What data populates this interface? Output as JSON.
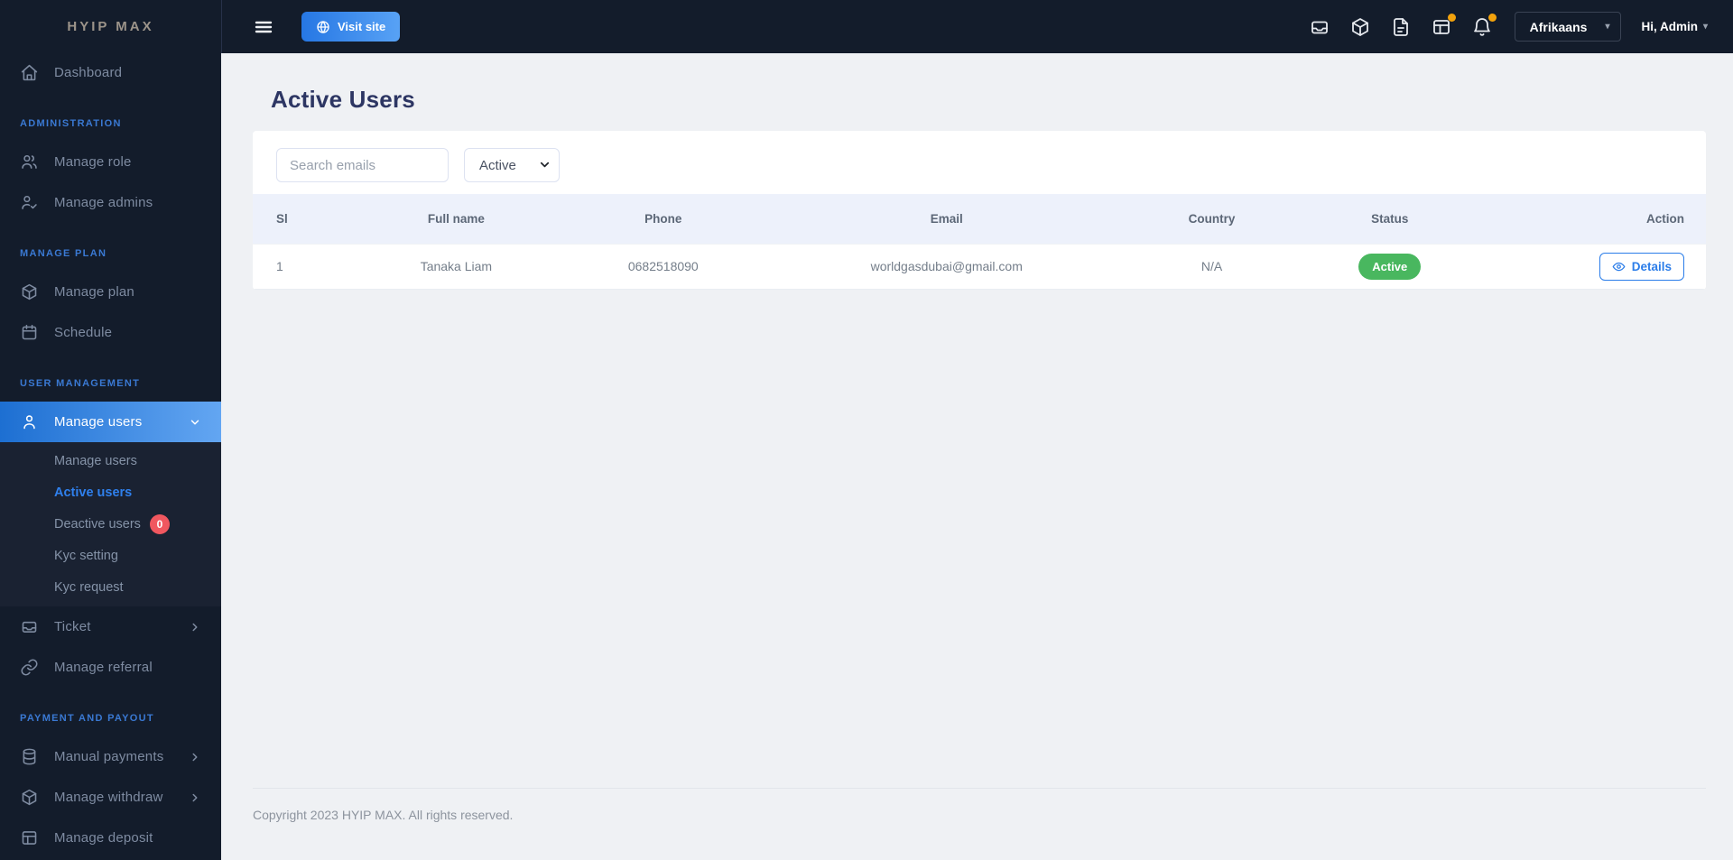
{
  "sidebar": {
    "brand": "HYIP MAX",
    "dashboard": "Dashboard",
    "sections": {
      "administration": "ADMINISTRATION",
      "manage_plan": "MANAGE PLAN",
      "user_management": "USER MANAGEMENT",
      "payment_and_payout": "PAYMENT AND PAYOUT"
    },
    "items": {
      "manage_role": "Manage role",
      "manage_admins": "Manage admins",
      "manage_plan": "Manage plan",
      "schedule": "Schedule",
      "manage_users": "Manage users",
      "ticket": "Ticket",
      "manage_referral": "Manage referral",
      "manual_payments": "Manual payments",
      "manage_withdraw": "Manage withdraw",
      "manage_deposit": "Manage deposit"
    },
    "submenu": {
      "manage_users": "Manage users",
      "active_users": "Active users",
      "deactive_users": "Deactive users",
      "deactive_badge": "0",
      "kyc_setting": "Kyc setting",
      "kyc_request": "Kyc request"
    }
  },
  "topbar": {
    "visit_site": "Visit site",
    "language": "Afrikaans",
    "greeting": "Hi, Admin",
    "caret": "▾",
    "icons": [
      "inbox-icon",
      "package-icon",
      "file-text-icon",
      "table-icon",
      "bell-icon"
    ]
  },
  "page": {
    "title": "Active Users"
  },
  "filters": {
    "search_placeholder": "Search emails",
    "status_value": "Active"
  },
  "table": {
    "headers": [
      "Sl",
      "Full name",
      "Phone",
      "Email",
      "Country",
      "Status",
      "Action"
    ],
    "rows": [
      {
        "sl": "1",
        "full_name": "Tanaka Liam",
        "phone": "0682518090",
        "email": "worldgasdubai@gmail.com",
        "country": "N/A",
        "status": "Active",
        "action": "Details"
      }
    ]
  },
  "footer": {
    "copyright": "Copyright 2023 HYIP MAX. All rights reserved."
  },
  "colors": {
    "sidebar_bg": "#131c2b",
    "accent_blue": "#2f80ed",
    "active_gradient_start": "#1d6fd2",
    "active_gradient_end": "#63a6f2",
    "status_green": "#49b75f",
    "badge_red": "#f0575f",
    "notification_orange": "#f2a20d",
    "header_band": "#edf1fb",
    "title_navy": "#2d3663"
  }
}
